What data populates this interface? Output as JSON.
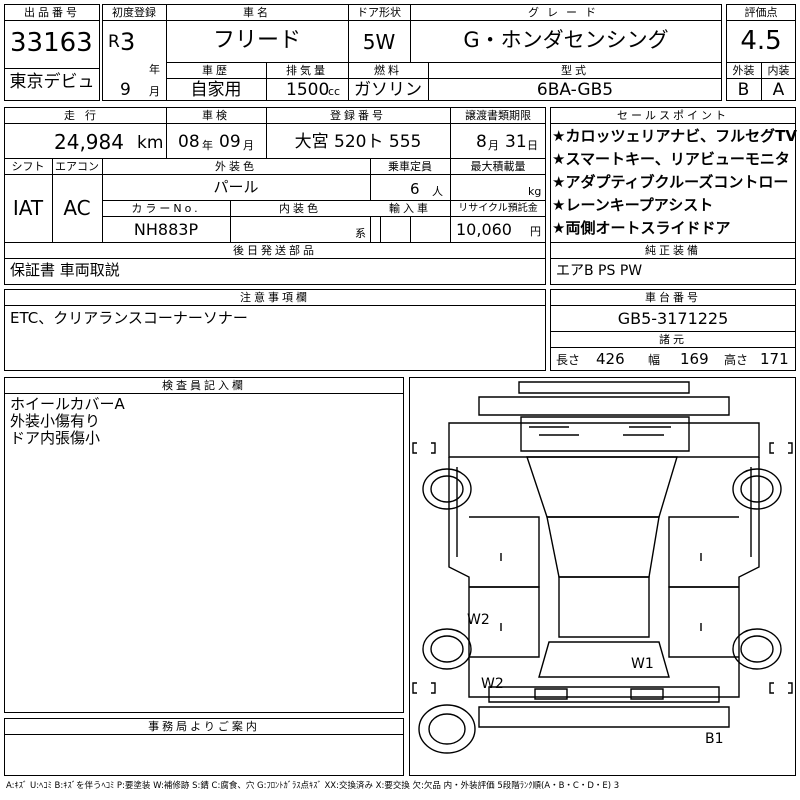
{
  "headers": {
    "lot_no": "出品番号",
    "first_reg": "初度登録",
    "car_name": "車名",
    "door_type": "ドア形状",
    "grade": "グレード",
    "score": "評価点",
    "history": "車歴",
    "displacement": "排気量",
    "fuel": "燃料",
    "model_code": "型式",
    "exterior": "外装",
    "interior": "内装",
    "mileage": "走行",
    "inspection": "車検",
    "reg_no": "登録番号",
    "transfer_deadline": "譲渡書類期限",
    "sales_points": "セールスポイント",
    "shift": "シフト",
    "aircon": "エアコン",
    "ext_color": "外装色",
    "capacity": "乗車定員",
    "max_load": "最大積載量",
    "color_no": "カラーNo.",
    "int_color": "内装色",
    "import": "輸入車",
    "recycle": "リサイクル預託金",
    "later_parts": "後日発送部品",
    "genuine": "純正装備",
    "notes": "注意事項欄",
    "chassis": "車台番号",
    "dims": "諸元",
    "inspector": "検査員記入欄",
    "office": "事務局よりご案内"
  },
  "lot_no": "33163",
  "venue": "東京デビュ",
  "first_reg": {
    "era": "R",
    "year": "3",
    "year_unit": "年",
    "month": "9",
    "month_unit": "月"
  },
  "car_name": "フリード",
  "door_type": "5W",
  "grade": "G・ホンダセンシング",
  "score": "4.5",
  "history": "自家用",
  "displacement": "1500",
  "displacement_unit": "cc",
  "fuel": "ガソリン",
  "model_code": "6BA-GB5",
  "exterior_grade": "B",
  "interior_grade": "A",
  "mileage": "24,984",
  "mileage_unit": "km",
  "inspection": {
    "year": "08",
    "year_unit": "年",
    "month": "09",
    "month_unit": "月"
  },
  "reg_no": "大宮 520ト 555",
  "transfer_deadline": {
    "month": "8",
    "month_unit": "月",
    "day": "31",
    "day_unit": "日"
  },
  "sales_points": [
    "★カロッツェリアナビ、フルセグTV",
    "★スマートキー、リアビューモニタ",
    "★アダプティブクルーズコントロー",
    "★レーンキープアシスト",
    "★両側オートスライドドア"
  ],
  "shift": "IAT",
  "aircon": "AC",
  "ext_color": "パール",
  "capacity": "6",
  "capacity_unit": "人",
  "max_load_unit": "kg",
  "color_no": "NH883P",
  "int_color_unit": "系",
  "recycle": "10,060",
  "recycle_unit": "円",
  "later_parts": "保証書 車両取説",
  "genuine": "エアB PS PW",
  "notes": "ETC、クリアランスコーナーソナー",
  "chassis": "GB5-3171225",
  "dims": {
    "length_label": "長さ",
    "length": "426",
    "width_label": "幅",
    "width": "169",
    "height_label": "高さ",
    "height": "171"
  },
  "inspector_notes": [
    "ホイールカバーA",
    "外装小傷有り",
    "ドア内張傷小"
  ],
  "diagram": {
    "marks": [
      "W2",
      "W1",
      "W2",
      "B1"
    ]
  },
  "legend": "A:ｷｽﾞ U:ﾍｺﾐ B:ｷｽﾞを伴うﾍｺﾐ P:要塗装 W:補修跡 S:錆 C:腐食、穴 G:ﾌﾛﾝﾄｶﾞﾗｽ点ｷｽﾞ XX:交換済み X:要交換 欠:欠品 内・外装評価 5段階ﾗﾝｸ順(A・B・C・D・E) 3"
}
